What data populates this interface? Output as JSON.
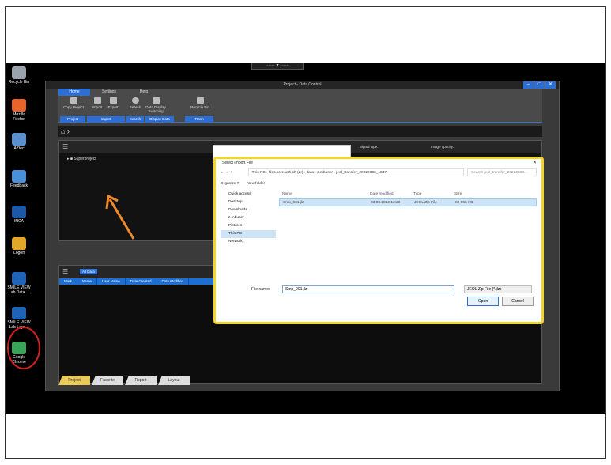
{
  "taskbar_tab": "······  ▾  ······",
  "desktop_icons": [
    {
      "label": "Recycle Bin",
      "color": "#9aa3ad"
    },
    {
      "label": "Mozilla Firefox",
      "color": "#e8642a"
    },
    {
      "label": "AZtec",
      "color": "#5a8fd0"
    },
    {
      "label": "Feedback",
      "color": "#4a90d9"
    },
    {
      "label": "INCA",
      "color": "#1d58a8"
    },
    {
      "label": "Logoff",
      "color": "#e2a628"
    },
    {
      "label": "SMILE VIEW Lab Data ...",
      "color": "#1e63b8"
    },
    {
      "label": "SMILE VIEW Lab Layo...",
      "color": "#1e63b8"
    },
    {
      "label": "Google Chrome",
      "color": "#3aa55a"
    }
  ],
  "app": {
    "title": "Project - Data Control",
    "window_buttons": [
      "–",
      "□",
      "✕"
    ],
    "ribbon_tabs": [
      "Home",
      "Settings",
      "Help"
    ],
    "ribbon_buttons": [
      "Copy Project",
      "Import",
      "Export",
      "Search",
      "Data Display Switching",
      "Recycle Bin"
    ],
    "ribbon_groups": [
      "Project",
      "Import",
      "Search",
      "Display Data",
      "Trash"
    ],
    "tree_item": "Superproject",
    "signal_type_label": "Signal type:",
    "image_opacity_label": "Image opacity:",
    "all_data_label": "All Data",
    "table_headers": [
      "Mark",
      "Name",
      "User Name",
      "Date Created",
      "Date Modified"
    ],
    "bottom_tabs": [
      "Project",
      "Favorite",
      "Report",
      "Layout"
    ]
  },
  "dialog": {
    "title": "Select Import File",
    "path": "This PC  ›  files.core.uzh.ch (Z:)  ›  data  ›  z.mbuser  ›  jeol_transfer_20220803_1347",
    "search_placeholder": "Search jeol_transfer_20220803...",
    "organize_label": "Organize ▾",
    "new_folder_label": "New folder",
    "nav_items": [
      "Quick access",
      "Desktop",
      "Downloads",
      "z.mbuser",
      "Pictures",
      "This PC",
      "Network"
    ],
    "columns": [
      "Name",
      "Date modified",
      "Type",
      "Size"
    ],
    "files": [
      {
        "name": "Smp_001.jlz",
        "date": "03.08.2022 13:26",
        "type": "JEOL Zip File",
        "size": "82 055 KB"
      }
    ],
    "filename_label": "File name:",
    "filename_value": "Smp_001.jlz",
    "filetype_value": "JEOL Zip File (*.jlz)",
    "open_label": "Open",
    "cancel_label": "Cancel"
  },
  "annotations": {
    "arrow_color": "#f08a2a",
    "circle_color": "#d21f1f",
    "dialog_highlight": "#f2d42b"
  }
}
